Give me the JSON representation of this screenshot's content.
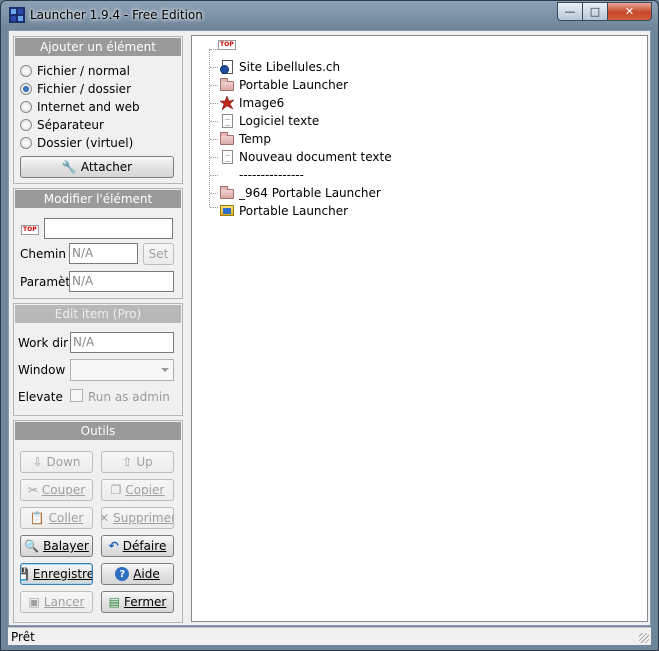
{
  "window": {
    "title": "Launcher 1.9.4 - Free Edition",
    "caption_min": "—",
    "caption_max": "□",
    "caption_close": "✕"
  },
  "add_item": {
    "header": "Ajouter un élément",
    "options": [
      {
        "label": "Fichier / normal",
        "checked": false
      },
      {
        "label": "Fichier / dossier",
        "checked": true
      },
      {
        "label": "Internet and web",
        "checked": false
      },
      {
        "label": "Séparateur",
        "checked": false
      },
      {
        "label": "Dossier (virtuel)",
        "checked": false
      }
    ],
    "attach_label": "Attacher"
  },
  "modify_item": {
    "header": "Modifier l'élément",
    "top_badge": "TOP",
    "name_value": "",
    "path_label": "Chemin :",
    "path_value": "N/A",
    "set_label": "Set",
    "params_label": "Paramètres",
    "params_value": "N/A"
  },
  "edit_pro": {
    "header": "Edit item (Pro)",
    "workdir_label": "Work dir",
    "workdir_value": "N/A",
    "window_label": "Window",
    "window_value": "",
    "elevate_label": "Elevate",
    "run_as_admin_label": "Run as admin"
  },
  "tools": {
    "header": "Outils",
    "buttons": [
      {
        "label": "Down",
        "enabled": false
      },
      {
        "label": "Up",
        "enabled": false
      },
      {
        "label": "Couper",
        "enabled": false
      },
      {
        "label": "Copier",
        "enabled": false
      },
      {
        "label": "Coller",
        "enabled": false
      },
      {
        "label": "Supprimer",
        "enabled": false
      },
      {
        "label": "Balayer",
        "enabled": true
      },
      {
        "label": "Défaire",
        "enabled": true
      },
      {
        "label": "Enregistrer",
        "enabled": true
      },
      {
        "label": "Aide",
        "enabled": true
      },
      {
        "label": "Lancer",
        "enabled": false
      },
      {
        "label": "Fermer",
        "enabled": true
      }
    ]
  },
  "tree": {
    "root_badge": "TOP",
    "items": [
      {
        "label": "Site Libellules.ch",
        "icon": "web-shortcut-icon"
      },
      {
        "label": "Portable Launcher",
        "icon": "folder-icon"
      },
      {
        "label": "Image6",
        "icon": "image-icon"
      },
      {
        "label": "Logiciel texte",
        "icon": "document-icon"
      },
      {
        "label": "Temp",
        "icon": "folder-icon"
      },
      {
        "label": "Nouveau document texte",
        "icon": "document-icon"
      },
      {
        "label": "---------------",
        "icon": "separator"
      },
      {
        "label": "_964 Portable Launcher",
        "icon": "folder-icon"
      },
      {
        "label": "Portable Launcher",
        "icon": "launcher-icon"
      }
    ]
  },
  "status": {
    "text": "Prêt"
  }
}
